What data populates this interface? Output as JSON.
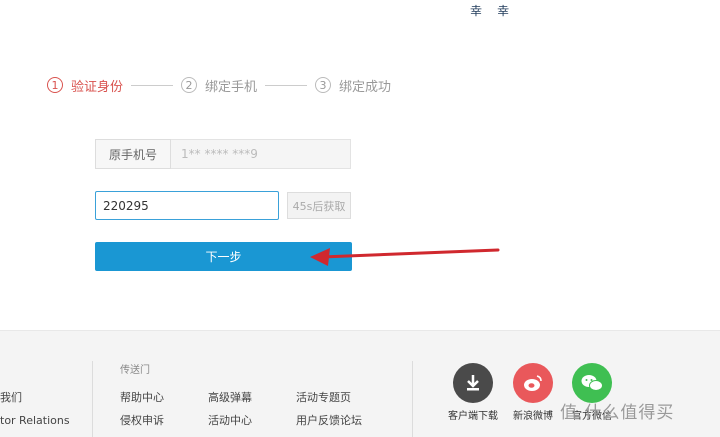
{
  "header": {
    "logo_fragment": [
      "幸",
      "幸"
    ]
  },
  "steps": [
    {
      "num": "1",
      "label": "验证身份",
      "active": true
    },
    {
      "num": "2",
      "label": "绑定手机",
      "active": false
    },
    {
      "num": "3",
      "label": "绑定成功",
      "active": false
    }
  ],
  "form": {
    "phone_label": "原手机号",
    "phone_value": "1** **** ***9",
    "code_value": "220295",
    "resend_label": "45s后获取",
    "next_label": "下一步"
  },
  "footer": {
    "left_items": [
      "我们",
      "tor Relations",
      ""
    ],
    "links_title": "传送门",
    "links": [
      "帮助中心",
      "高级弹幕",
      "活动专题页",
      "侵权申诉",
      "活动中心",
      "用户反馈论坛",
      "",
      "",
      ""
    ],
    "social": [
      {
        "label": "客户端下载",
        "color": "#4a4a4a",
        "icon": "download-icon"
      },
      {
        "label": "新浪微博",
        "color": "#e9585b",
        "icon": "weibo-icon"
      },
      {
        "label": "官方微信",
        "color": "#3fbf52",
        "icon": "wechat-icon"
      }
    ]
  },
  "watermark": "值 什么值得买"
}
